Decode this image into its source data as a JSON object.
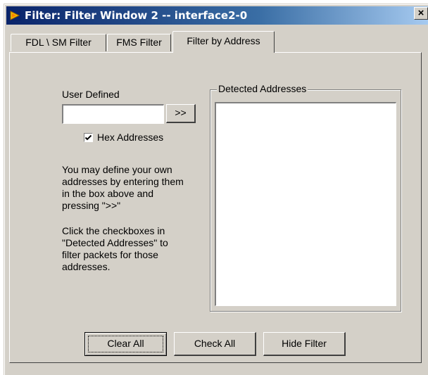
{
  "window": {
    "title": "Filter: Filter Window 2 -- interface2-0",
    "close_glyph": "×",
    "icon": "labview-icon"
  },
  "tabs": [
    {
      "label": "FDL \\ SM Filter",
      "active": false
    },
    {
      "label": "FMS Filter",
      "active": false
    },
    {
      "label": "Filter by Address",
      "active": true
    }
  ],
  "user_defined": {
    "label": "User Defined",
    "input_value": "",
    "add_button": ">>",
    "hex_checkbox_label": "Hex Addresses",
    "hex_checked": true
  },
  "help": {
    "paragraph1": "You may define your own\naddresses by entering them\nin the box above and\npressing \">>\"",
    "paragraph2": "Click the checkboxes in\n\"Detected Addresses\" to\nfilter packets for those\naddresses."
  },
  "detected": {
    "title": "Detected Addresses",
    "items": []
  },
  "buttons": {
    "clear_all": "Clear All",
    "check_all": "Check All",
    "hide_filter": "Hide Filter"
  }
}
